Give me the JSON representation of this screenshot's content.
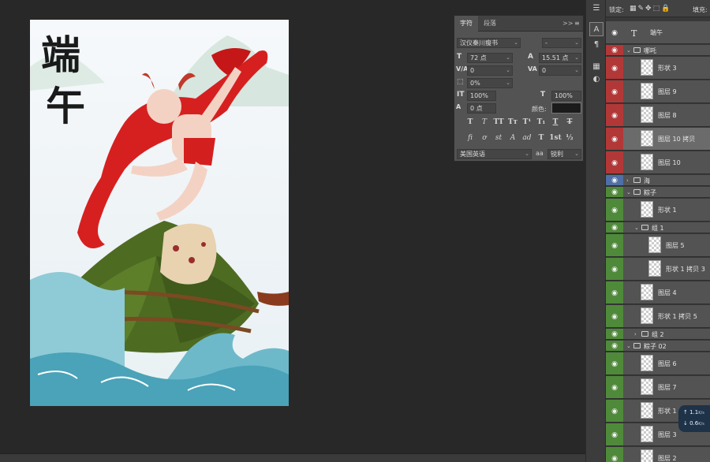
{
  "character_panel": {
    "tabs": [
      {
        "label": "字符",
        "active": true
      },
      {
        "label": "段落",
        "active": false
      }
    ],
    "collapse_label": ">>",
    "menu_label": "≡",
    "font_family": "汉仪秦川瘦书",
    "font_style": "-",
    "font_size": "72 点",
    "leading": "15.51 点",
    "kerning": "0",
    "tracking": "0",
    "tsume": "0%",
    "vertical_scale": "100%",
    "horizontal_scale": "100%",
    "baseline_shift": "0 点",
    "color_label": "颜色:",
    "color_value": "#1b1b1b",
    "format_buttons": [
      "T",
      "T",
      "TT",
      "Tт",
      "T¹",
      "T₁",
      "T",
      "T"
    ],
    "opentype_buttons": [
      "fi",
      "ơ",
      "st",
      "A",
      "ad",
      "T",
      "1st",
      "½"
    ],
    "language": "美国英语",
    "aa_icon": "aa",
    "antialias": "锐利"
  },
  "layers_panel": {
    "lock_label": "锁定:",
    "fill_label": "填充:",
    "layers": [
      {
        "name": "端午",
        "kind": "text",
        "indent": 0,
        "color": "none"
      },
      {
        "name": "哪吒",
        "kind": "group",
        "indent": 0,
        "color": "red",
        "expanded": true
      },
      {
        "name": "形状 3",
        "kind": "layer",
        "indent": 1,
        "color": "red"
      },
      {
        "name": "图层 9",
        "kind": "layer",
        "indent": 1,
        "color": "red"
      },
      {
        "name": "图层 8",
        "kind": "layer",
        "indent": 1,
        "color": "red"
      },
      {
        "name": "图层 10 拷贝",
        "kind": "layer",
        "indent": 1,
        "color": "red",
        "selected": true
      },
      {
        "name": "图层 10",
        "kind": "layer",
        "indent": 1,
        "color": "red"
      },
      {
        "name": "海",
        "kind": "group",
        "indent": 0,
        "color": "blue",
        "expanded": false
      },
      {
        "name": "粽子",
        "kind": "group",
        "indent": 0,
        "color": "green",
        "expanded": true
      },
      {
        "name": "形状 1",
        "kind": "layer",
        "indent": 1,
        "color": "green"
      },
      {
        "name": "组 1",
        "kind": "group",
        "indent": 1,
        "color": "green",
        "expanded": true
      },
      {
        "name": "图层 5",
        "kind": "layer",
        "indent": 2,
        "color": "green"
      },
      {
        "name": "形状 1 拷贝 3",
        "kind": "layer",
        "indent": 2,
        "color": "green"
      },
      {
        "name": "图层 4",
        "kind": "layer",
        "indent": 1,
        "color": "green"
      },
      {
        "name": "形状 1 拷贝 5",
        "kind": "layer",
        "indent": 1,
        "color": "green"
      },
      {
        "name": "组 2",
        "kind": "group",
        "indent": 1,
        "color": "green",
        "expanded": false
      },
      {
        "name": "粽子 02",
        "kind": "group",
        "indent": 0,
        "color": "green",
        "expanded": true
      },
      {
        "name": "图层 6",
        "kind": "layer",
        "indent": 1,
        "color": "green"
      },
      {
        "name": "图层 7",
        "kind": "layer",
        "indent": 1,
        "color": "green"
      },
      {
        "name": "形状 1 拷贝 2",
        "kind": "layer",
        "indent": 1,
        "color": "green"
      },
      {
        "name": "图层 3",
        "kind": "layer",
        "indent": 1,
        "color": "green"
      },
      {
        "name": "图层 2",
        "kind": "layer",
        "indent": 1,
        "color": "green"
      }
    ]
  },
  "artwork": {
    "title_chars": [
      "端",
      "午"
    ]
  },
  "net_widget": {
    "upload": "1.1",
    "download": "0.6",
    "unit": "K/s"
  },
  "colors": {
    "label_red": "#b23838",
    "label_green": "#4f8a3a",
    "label_blue": "#4f6fa6",
    "panel_bg": "#535353",
    "workspace_bg": "#282828"
  }
}
